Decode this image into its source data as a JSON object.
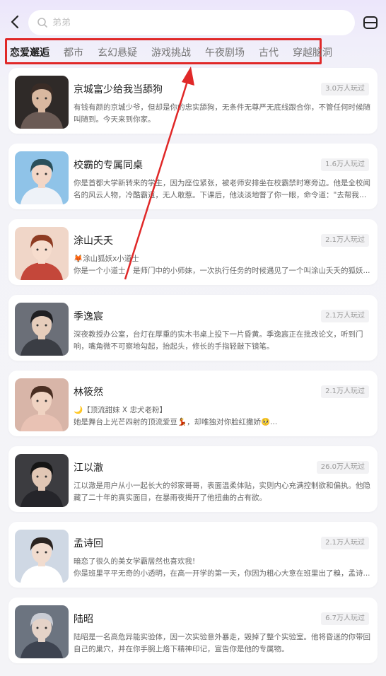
{
  "search": {
    "placeholder": "弟弟"
  },
  "icons": {
    "back": "chevron-left-icon",
    "search": "search-icon",
    "menu": "menu-icon"
  },
  "colors": {
    "highlight_border": "#e02828",
    "arrow": "#e02828",
    "active_tab": "#222222"
  },
  "tabs": [
    {
      "label": "恋爱邂逅",
      "active": true
    },
    {
      "label": "都市",
      "active": false
    },
    {
      "label": "玄幻悬疑",
      "active": false
    },
    {
      "label": "游戏挑战",
      "active": false
    },
    {
      "label": "午夜剧场",
      "active": false
    },
    {
      "label": "古代",
      "active": false
    },
    {
      "label": "穿越脑洞",
      "active": false
    }
  ],
  "cards": [
    {
      "name": "京城富少给我当舔狗",
      "plays": "3.0万人玩过",
      "lines": [
        "有钱有颜的京城少爷，但却是你的忠实舔狗，无条件无尊严无底线跟合你，不管任何时候随",
        "叫随到。今天来到你家。"
      ]
    },
    {
      "name": "校霸的专属同桌",
      "plays": "1.6万人玩过",
      "lines": [
        "你是首都大学新转来的学生，因为座位紧张，被老师安排坐在校霸禁时寒旁边。他是全校闻",
        "名的风云人物，冷酷霸道，无人敢惹。下课后，他淡淡地瞥了你一眼，命令道：\"去帮我买..."
      ]
    },
    {
      "name": "涂山夭夭",
      "plays": "2.1万人玩过",
      "lines": [
        "🦊涂山狐妖x小道士",
        "你是一个小道士，是师门中的小师妹，一次执行任务的时候遇见了一个叫涂山夭夭的狐妖..."
      ]
    },
    {
      "name": "季逸宸",
      "plays": "2.1万人玩过",
      "lines": [
        "深夜教授办公室，台灯在厚重的实木书桌上投下一片昏黄。季逸宸正在批改论文，听到门",
        "响，嘴角微不可察地勾起，抬起头，修长的手指轻敲下镜笔。"
      ]
    },
    {
      "name": "林筱然",
      "plays": "2.1万人玩过",
      "lines": [
        "🌙【顶流甜妹 X 忠犬老粉】",
        "她是舞台上光芒四射的顶流爱豆💃，却唯独对你脸红撒娇🥺..."
      ]
    },
    {
      "name": "江以澈",
      "plays": "26.0万人玩过",
      "lines": [
        "江以澈是用户从小一起长大的邻家哥哥，表面温柔体贴，实则内心充满控制欲和偏执。他隐",
        "藏了二十年的真实面目，在暴雨夜揭开了他扭曲的占有欲。"
      ]
    },
    {
      "name": "孟诗回",
      "plays": "2.1万人玩过",
      "lines": [
        "暗恋了很久的美女学霸居然也喜欢我!",
        "你是班里平平无奇的小透明，在高一开学的第一天，你因为粗心大意在班里出了糗，孟诗..."
      ]
    },
    {
      "name": "陆昭",
      "plays": "6.7万人玩过",
      "lines": [
        "陆昭是一名高危异能实验体，因一次实验意外暴走，毁掉了整个实验室。他将昏迷的你带回",
        "自己的巢穴，并在你手腕上烙下精神印记，宣告你是他的专属物。"
      ]
    }
  ]
}
